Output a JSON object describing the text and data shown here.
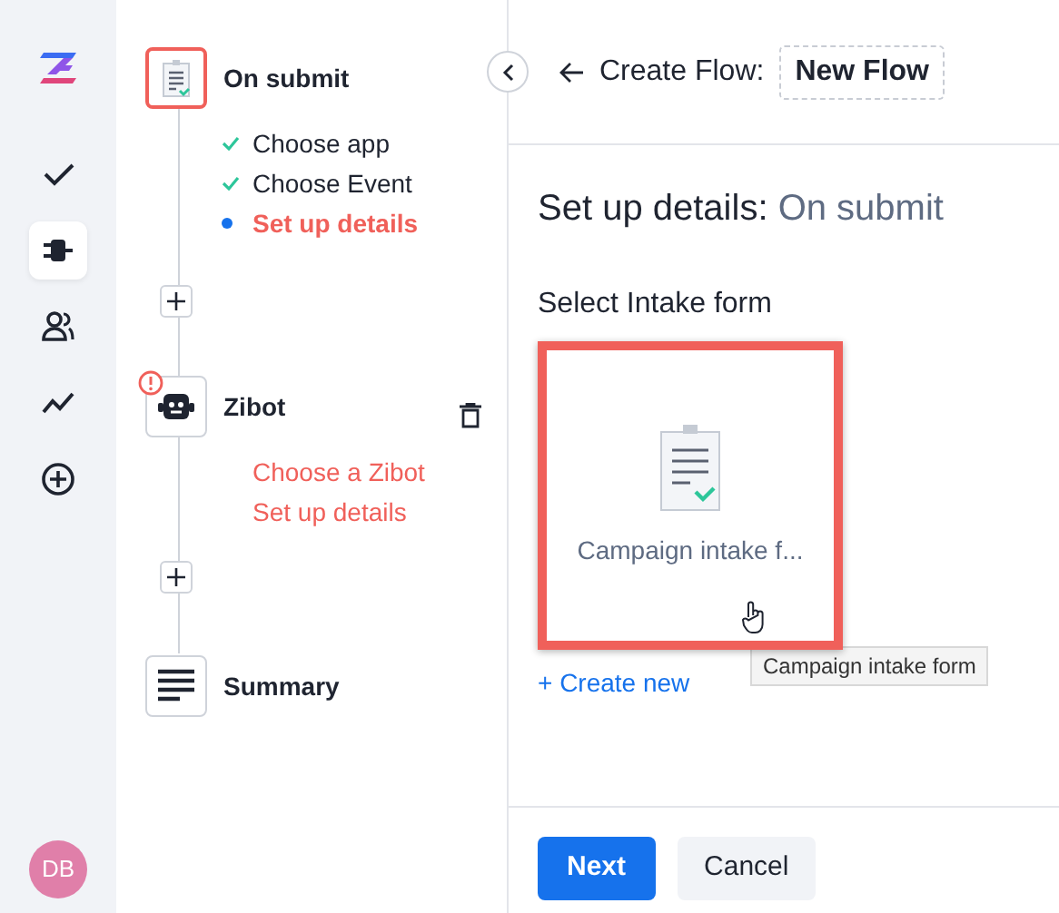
{
  "rail": {
    "items": [
      {
        "kind": "check",
        "selected": false
      },
      {
        "kind": "plug",
        "selected": true
      },
      {
        "kind": "people",
        "selected": false
      },
      {
        "kind": "trend",
        "selected": false
      },
      {
        "kind": "add",
        "selected": false
      }
    ],
    "avatar": {
      "initials": "DB"
    }
  },
  "steps": [
    {
      "title": "On submit",
      "kind": "form",
      "selected": true,
      "error": false,
      "deletable": false,
      "substeps": [
        {
          "label": "Choose app",
          "checked": true,
          "selected": false
        },
        {
          "label": "Choose Event",
          "checked": true,
          "selected": false
        },
        {
          "label": "Set up details",
          "checked": false,
          "selected": true
        }
      ]
    },
    {
      "title": "Zibot",
      "kind": "bot",
      "selected": false,
      "error": true,
      "deletable": true,
      "substeps": [
        {
          "label": "Choose a Zibot",
          "checked": false,
          "selected": false
        },
        {
          "label": "Set up details",
          "checked": false,
          "selected": false
        }
      ]
    },
    {
      "title": "Summary",
      "kind": "summary",
      "selected": false,
      "error": false,
      "deletable": false
    }
  ],
  "header": {
    "title": "Create Flow:",
    "flow_name": "New Flow"
  },
  "content": {
    "heading": "Set up details:",
    "heading_step": "On submit",
    "field_label": "Select Intake form",
    "forms": [
      {
        "label": "Campaign intake f...",
        "selected": true,
        "tooltip": "Campaign intake form"
      }
    ],
    "create_new": "+ Create new"
  },
  "buttons": [
    {
      "label": "Next",
      "kind": "primary"
    },
    {
      "label": "Cancel",
      "kind": "secondary"
    }
  ]
}
